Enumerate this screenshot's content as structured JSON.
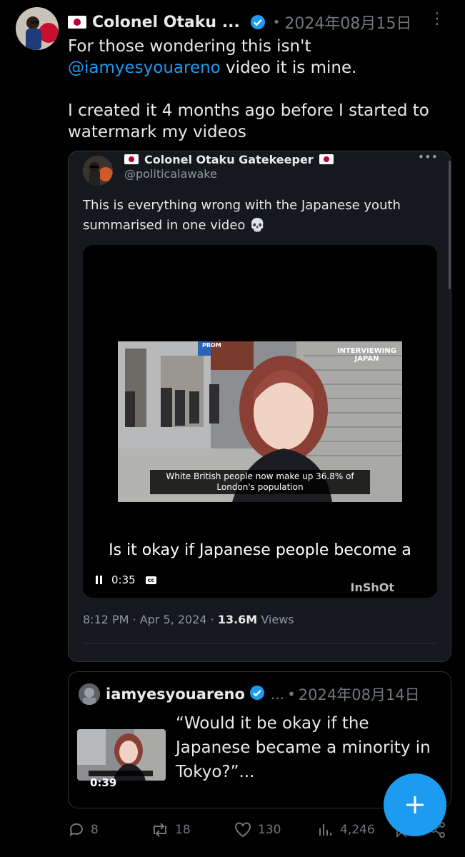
{
  "post": {
    "author_name": "Colonel Otaku ...",
    "date": "2024年08月15日",
    "text_line1": "For those wondering this isn't",
    "mention": "@iamyesyouareno",
    "text_line2_rest": " video it is mine.",
    "text_para2": "I created it 4 months ago before I started to watermark my videos"
  },
  "quoted": {
    "author_name": "Colonel Otaku Gatekeeper",
    "handle": "@politicalawake",
    "text": "This is everything wrong with the Japanese youth summarised in one video 💀",
    "video": {
      "overlay_title": "INTERVIEWING\nJAPAN",
      "subtitle": "White British people now make up 36.8% of London's population",
      "caption": "Is it okay if Japanese people become a",
      "time": "0:35",
      "cc": "cc",
      "watermark": "InShOt",
      "shop_sign": "PROM"
    },
    "meta_time": "8:12 PM · Apr 5, 2024 · ",
    "meta_views_count": "13.6M",
    "meta_views_label": " Views"
  },
  "quoted2": {
    "author_name": "iamyesyouareno",
    "ellipsis": "...",
    "date": "2024年08月14日",
    "text": "“Would it be okay if the Japanese became a minority in Tokyo?”...",
    "thumb_duration": "0:39"
  },
  "actions": {
    "replies": "8",
    "reposts": "18",
    "likes": "130",
    "views": "4,246"
  },
  "colors": {
    "accent": "#1d9bf0",
    "muted": "#71767b",
    "background": "#000000"
  },
  "icons": [
    "verified-badge-icon",
    "more-options-icon",
    "skull-icon",
    "pause-icon",
    "closed-captions-icon",
    "reply-icon",
    "repost-icon",
    "like-icon",
    "views-icon",
    "bookmark-icon",
    "share-icon",
    "compose-plus-icon"
  ]
}
